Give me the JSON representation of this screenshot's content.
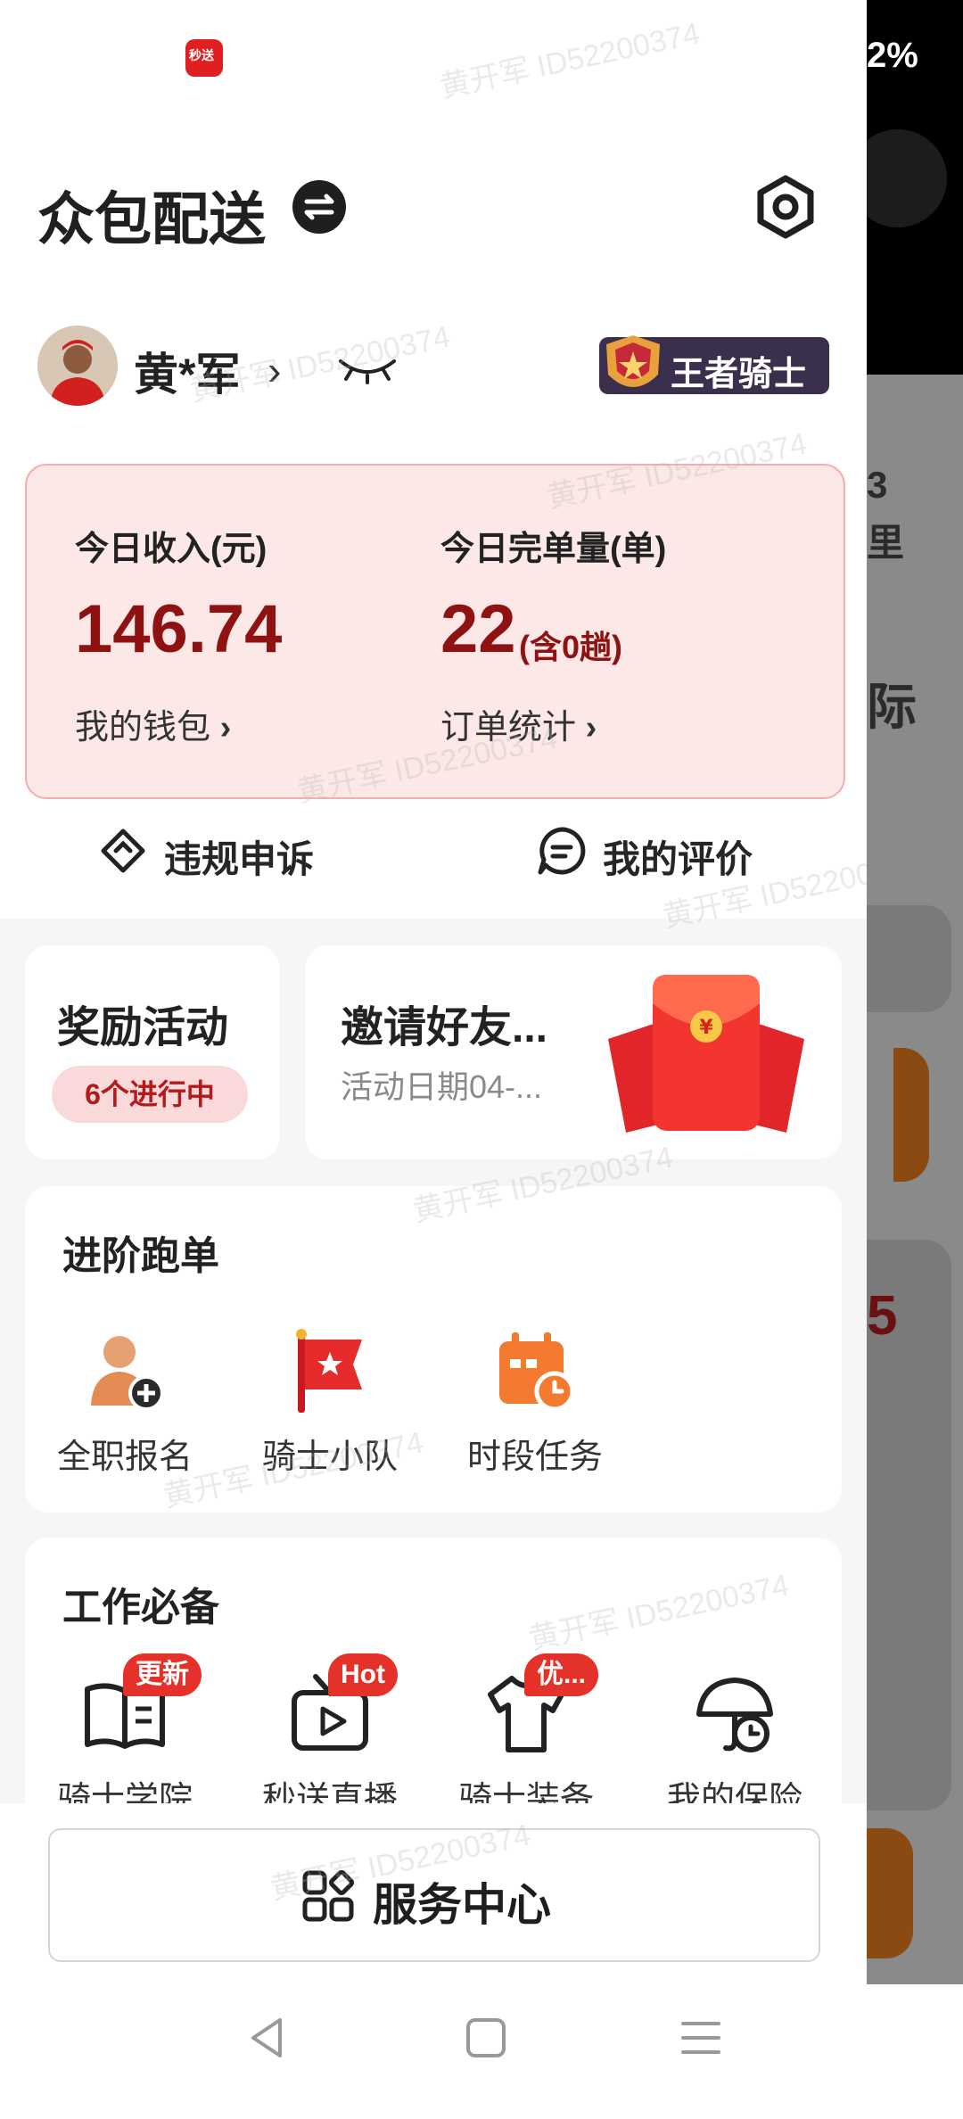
{
  "status_bar": {
    "battery_text": "2%"
  },
  "header": {
    "title": "众包配送"
  },
  "user": {
    "name": "黄*军",
    "rank_badge": "王者骑士"
  },
  "income_card": {
    "income_label": "今日收入(元)",
    "income_value": "146.74",
    "wallet_link": "我的钱包",
    "orders_label": "今日完单量(单)",
    "orders_value": "22",
    "orders_note": "(含0趟)",
    "stats_link": "订单统计"
  },
  "actions": {
    "appeal": "违规申诉",
    "review": "我的评价"
  },
  "reward": {
    "title": "奖励活动",
    "status": "6个进行中"
  },
  "invite": {
    "title": "邀请好友...",
    "subtitle": "活动日期04-..."
  },
  "advanced": {
    "title": "进阶跑单",
    "items": [
      {
        "label": "全职报名",
        "icon": "fulltime-signup-icon"
      },
      {
        "label": "骑士小队",
        "icon": "knight-team-flag-icon"
      },
      {
        "label": "时段任务",
        "icon": "time-task-calendar-icon"
      }
    ]
  },
  "essentials": {
    "title": "工作必备",
    "items": [
      {
        "label": "骑士学院",
        "tag": "更新",
        "icon": "book-icon"
      },
      {
        "label": "秒送直播",
        "tag": "Hot",
        "icon": "tv-play-icon"
      },
      {
        "label": "骑士装备",
        "tag": "优...",
        "icon": "tshirt-icon"
      },
      {
        "label": "我的保险",
        "tag": "",
        "icon": "umbrella-clock-icon"
      }
    ]
  },
  "service_center": {
    "label": "服务中心"
  },
  "watermark": "黄开军 ID52200374",
  "background_app": {
    "fragment_1": "3",
    "fragment_2": "里",
    "fragment_3": "际",
    "fragment_4": "5"
  }
}
